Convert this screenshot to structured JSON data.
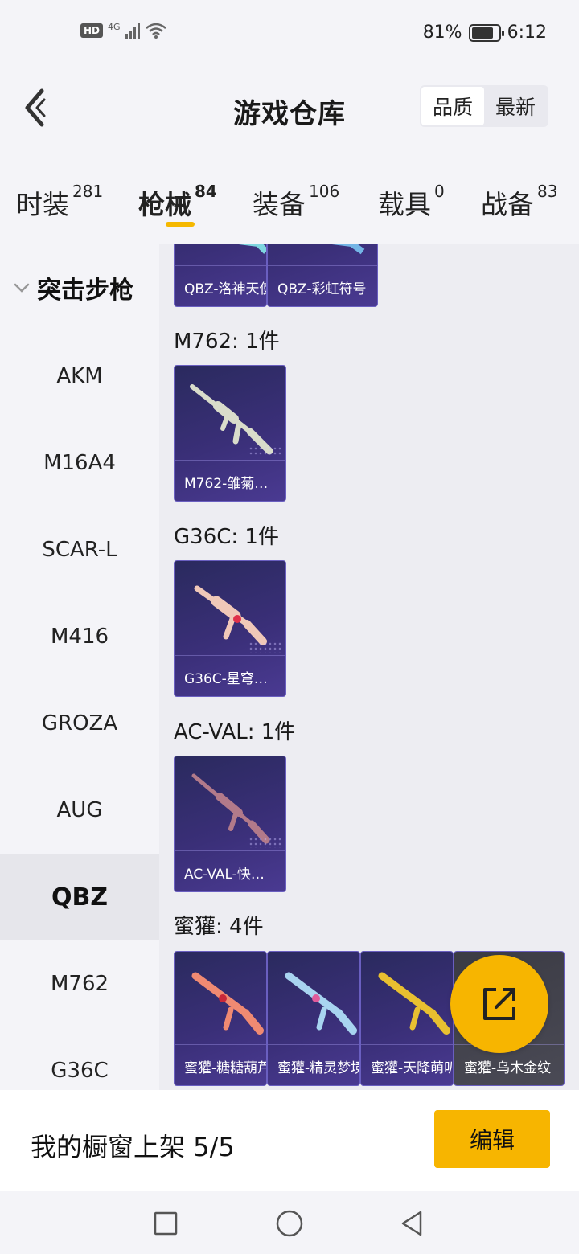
{
  "status_bar": {
    "hd_label": "HD",
    "network_type": "4G",
    "battery_text": "81%",
    "battery_level": 0.81,
    "time": "6:12"
  },
  "header": {
    "back_icon": "chevron-left-icon",
    "title": "游戏仓库",
    "sort_options": [
      "品质",
      "最新"
    ],
    "sort_selected": "品质"
  },
  "tabs": [
    {
      "label": "时装",
      "count": "281",
      "active": false
    },
    {
      "label": "枪械",
      "count": "84",
      "active": true
    },
    {
      "label": "装备",
      "count": "106",
      "active": false
    },
    {
      "label": "载具",
      "count": "0",
      "active": false
    },
    {
      "label": "战备",
      "count": "83",
      "active": false
    }
  ],
  "sidebar": {
    "group_label": "突击步枪",
    "items": [
      "AKM",
      "M16A4",
      "SCAR-L",
      "M416",
      "GROZA",
      "AUG",
      "QBZ",
      "M762",
      "G36C"
    ],
    "active_item": "QBZ"
  },
  "content": {
    "top_partial_cards": [
      "QBZ-洛神天使",
      "QBZ-彩虹符号"
    ],
    "sections": [
      {
        "title": "M762: 1件",
        "cards": [
          "M762-雏菊…"
        ]
      },
      {
        "title": "G36C: 1件",
        "cards": [
          "G36C-星穹…"
        ]
      },
      {
        "title": "AC-VAL: 1件",
        "cards": [
          "AC-VAL-快…"
        ]
      },
      {
        "title": "蜜獾: 4件",
        "cards": [
          "蜜獾-糖糖葫芦",
          "蜜獾-精灵梦境",
          "蜜獾-天降萌叭",
          "蜜獾-乌木金纹"
        ]
      }
    ]
  },
  "fab": {
    "icon": "share-external-icon",
    "color": "#f7b500"
  },
  "bottom_bar": {
    "shelf_text": "我的橱窗上架 5/5",
    "edit_label": "编辑"
  },
  "nav_bar": {
    "icons": [
      "recent-apps-icon",
      "home-icon",
      "back-icon"
    ]
  },
  "colors": {
    "accent": "#f7b500",
    "card_bg": "#3a2f78"
  }
}
